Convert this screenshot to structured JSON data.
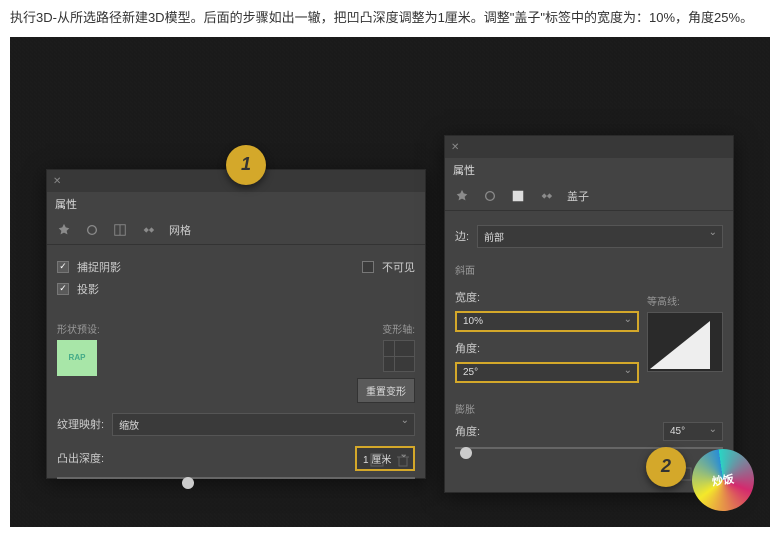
{
  "instruction": "执行3D-从所选路径新建3D模型。后面的步骤如出一辙，把凹凸深度调整为1厘米。调整\"盖子\"标签中的宽度为：10%，角度25%。",
  "badges": {
    "b1": "1",
    "b2": "2"
  },
  "panel1": {
    "title": "属性",
    "tab_label": "网格",
    "capture_shadow": {
      "label": "捕捉阴影",
      "checked": true
    },
    "invisible": {
      "label": "不可见",
      "checked": false
    },
    "projection": {
      "label": "投影",
      "checked": true
    },
    "shape_preset_label": "形状预设:",
    "preset_text": "RAP",
    "deform_axis_label": "变形轴:",
    "reset_deform": "重置变形",
    "texture_map_label": "纹理映射:",
    "texture_map_value": "缩放",
    "extrude_depth_label": "凸出深度:",
    "extrude_depth_value": "1 厘米"
  },
  "panel2": {
    "title": "属性",
    "tab_label": "盖子",
    "edge_label": "边:",
    "edge_value": "前部",
    "bevel_section": "斜面",
    "width_label": "宽度:",
    "width_value": "10%",
    "angle_label": "角度:",
    "angle_value": "25°",
    "contour_label": "等高线:",
    "inflate_section": "膨胀",
    "inflate_angle_label": "角度:",
    "inflate_angle_value": "45°"
  }
}
